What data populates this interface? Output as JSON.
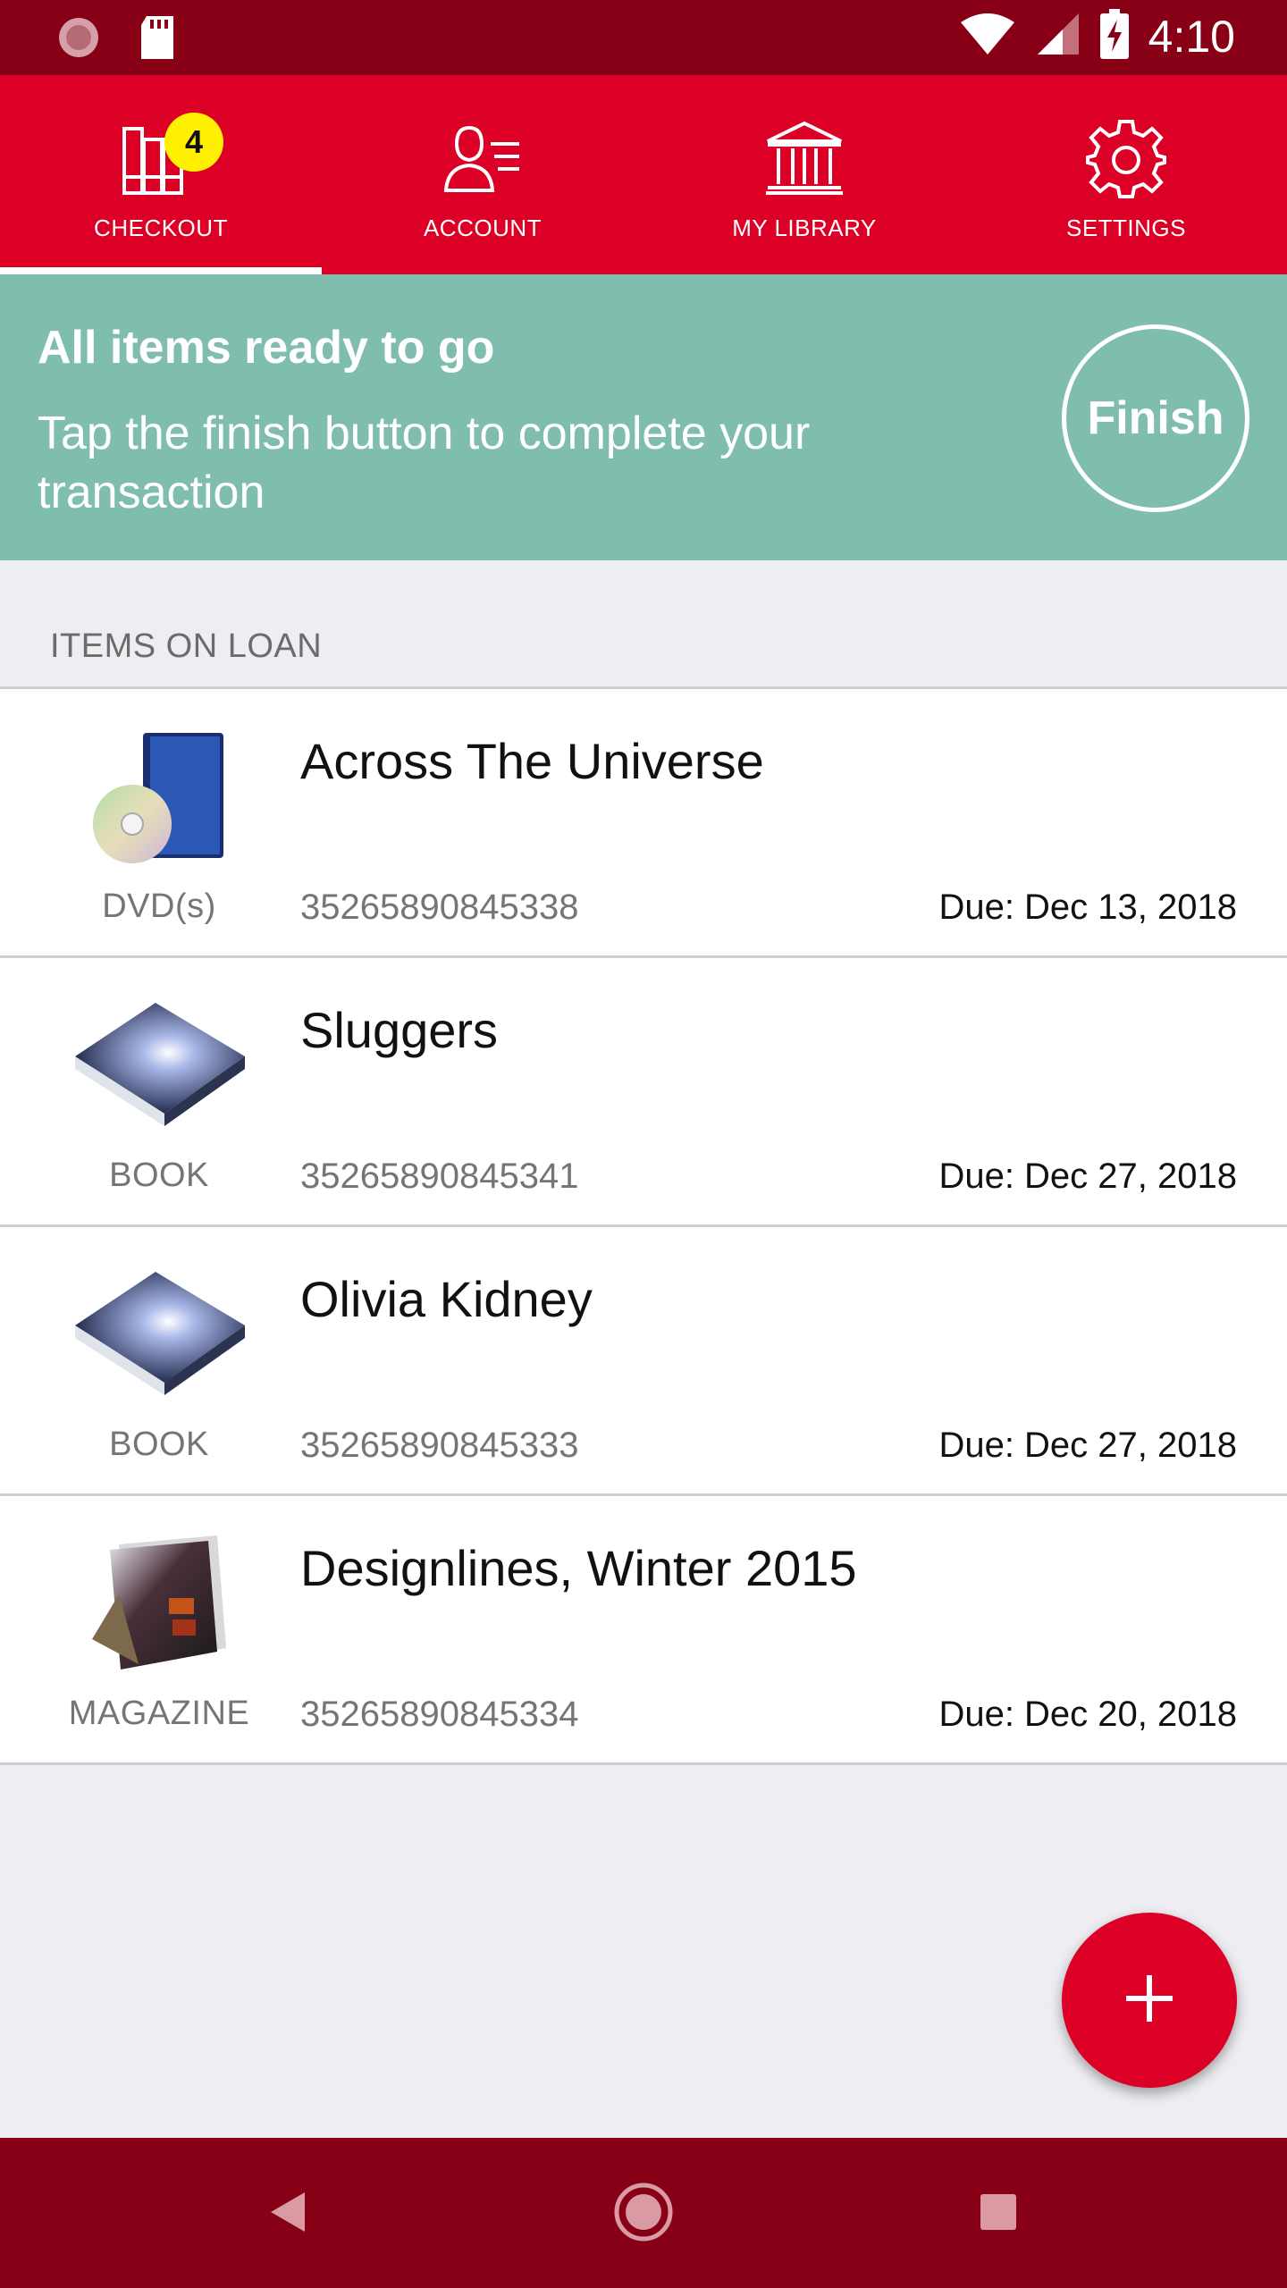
{
  "status_bar": {
    "time": "4:10",
    "icons": [
      "sync-icon",
      "sd-card-icon",
      "wifi-icon",
      "signal-icon",
      "battery-charging-icon"
    ]
  },
  "tabs": [
    {
      "label": "CHECKOUT",
      "icon": "books-icon",
      "badge": "4",
      "active": true
    },
    {
      "label": "ACCOUNT",
      "icon": "account-icon",
      "active": false
    },
    {
      "label": "MY LIBRARY",
      "icon": "library-icon",
      "active": false
    },
    {
      "label": "SETTINGS",
      "icon": "gear-icon",
      "active": false
    }
  ],
  "banner": {
    "title": "All items ready to go",
    "subtitle": "Tap the finish button to complete your transaction",
    "finish_label": "Finish",
    "color": "#7fbeae"
  },
  "section": {
    "header": "ITEMS ON LOAN"
  },
  "items": [
    {
      "type": "DVD(s)",
      "title": "Across The Universe",
      "barcode": "35265890845338",
      "due": "Due: Dec 13, 2018",
      "icon": "dvd-icon"
    },
    {
      "type": "BOOK",
      "title": "Sluggers",
      "barcode": "35265890845341",
      "due": "Due: Dec 27, 2018",
      "icon": "book-icon"
    },
    {
      "type": "BOOK",
      "title": "Olivia Kidney",
      "barcode": "35265890845333",
      "due": "Due: Dec 27, 2018",
      "icon": "book-icon"
    },
    {
      "type": "MAGAZINE",
      "title": "Designlines, Winter 2015",
      "barcode": "35265890845334",
      "due": "Due: Dec 20, 2018",
      "icon": "magazine-icon"
    }
  ],
  "colors": {
    "status_bar": "#870015",
    "tab_bar": "#dc0026",
    "badge": "#ffef00",
    "fab": "#dc0026",
    "background": "#eeeef2"
  }
}
